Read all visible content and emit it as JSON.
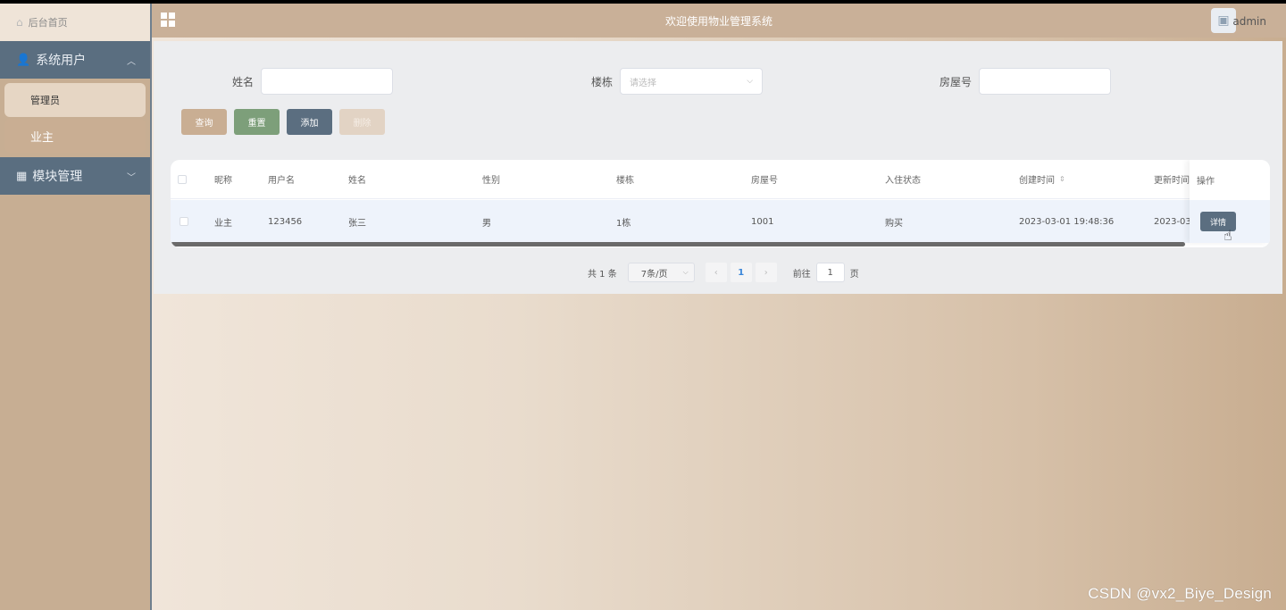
{
  "sidebar": {
    "home": "后台首页",
    "groups": [
      {
        "label": "系统用户",
        "icon": "user-icon",
        "expanded": true,
        "items": [
          {
            "label": "管理员"
          },
          {
            "label": "业主"
          }
        ]
      },
      {
        "label": "模块管理",
        "icon": "grid-icon",
        "expanded": false
      }
    ]
  },
  "header": {
    "title": "欢迎使用物业管理系统",
    "username": "admin"
  },
  "search": {
    "name_label": "姓名",
    "building_label": "楼栋",
    "building_placeholder": "请选择",
    "room_label": "房屋号"
  },
  "buttons": {
    "query": "查询",
    "reset": "重置",
    "add": "添加",
    "delete": "删除"
  },
  "table": {
    "columns": [
      "昵称",
      "用户名",
      "姓名",
      "性别",
      "楼栋",
      "房屋号",
      "入住状态",
      "创建时间",
      "更新时间",
      "操作"
    ],
    "rows": [
      {
        "nickname": "业主",
        "username": "123456",
        "name": "张三",
        "gender": "男",
        "building": "1栋",
        "room": "1001",
        "status": "购买",
        "created": "2023-03-01 19:48:36",
        "updated": "2023-03",
        "action": "详情"
      }
    ]
  },
  "pagination": {
    "total": "共 1 条",
    "page_size": "7条/页",
    "current": "1",
    "goto_label": "前往",
    "goto_value": "1",
    "page_suffix": "页"
  },
  "watermark": "CSDN @vx2_Biye_Design"
}
